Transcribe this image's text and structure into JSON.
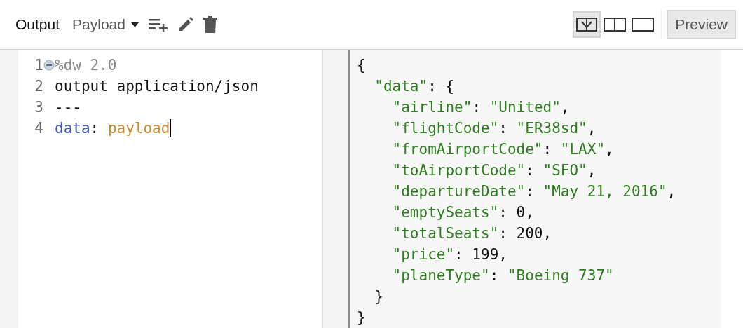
{
  "toolbar": {
    "title": "Output",
    "target": "Payload",
    "view_modes": [
      {
        "kind": "diff",
        "selected": true
      },
      {
        "kind": "split",
        "selected": false
      },
      {
        "kind": "single",
        "selected": false
      }
    ],
    "preview_button": "Preview"
  },
  "editor": {
    "lines": [
      {
        "number": "1",
        "foldable": true,
        "cursor": false,
        "tokens": [
          {
            "kind": "directive",
            "text": "%dw 2.0"
          }
        ]
      },
      {
        "number": "2",
        "foldable": false,
        "cursor": false,
        "tokens": [
          {
            "kind": "plain",
            "text": "output application/json"
          }
        ]
      },
      {
        "number": "3",
        "foldable": false,
        "cursor": false,
        "tokens": [
          {
            "kind": "plain",
            "text": "---"
          }
        ]
      },
      {
        "number": "4",
        "foldable": false,
        "cursor": true,
        "tokens": [
          {
            "kind": "field",
            "text": "data"
          },
          {
            "kind": "plain",
            "text": ": "
          },
          {
            "kind": "value",
            "text": "payload"
          }
        ]
      }
    ]
  },
  "preview": {
    "lines": [
      [
        {
          "kind": "punct",
          "text": "{"
        }
      ],
      [
        {
          "kind": "key",
          "text": "  \"data\""
        },
        {
          "kind": "punct",
          "text": ": {"
        }
      ],
      [
        {
          "kind": "key",
          "text": "    \"airline\""
        },
        {
          "kind": "punct",
          "text": ": "
        },
        {
          "kind": "string",
          "text": "\"United\""
        },
        {
          "kind": "punct",
          "text": ","
        }
      ],
      [
        {
          "kind": "key",
          "text": "    \"flightCode\""
        },
        {
          "kind": "punct",
          "text": ": "
        },
        {
          "kind": "string",
          "text": "\"ER38sd\""
        },
        {
          "kind": "punct",
          "text": ","
        }
      ],
      [
        {
          "kind": "key",
          "text": "    \"fromAirportCode\""
        },
        {
          "kind": "punct",
          "text": ": "
        },
        {
          "kind": "string",
          "text": "\"LAX\""
        },
        {
          "kind": "punct",
          "text": ","
        }
      ],
      [
        {
          "kind": "key",
          "text": "    \"toAirportCode\""
        },
        {
          "kind": "punct",
          "text": ": "
        },
        {
          "kind": "string",
          "text": "\"SFO\""
        },
        {
          "kind": "punct",
          "text": ","
        }
      ],
      [
        {
          "kind": "key",
          "text": "    \"departureDate\""
        },
        {
          "kind": "punct",
          "text": ": "
        },
        {
          "kind": "string",
          "text": "\"May 21, 2016\""
        },
        {
          "kind": "punct",
          "text": ","
        }
      ],
      [
        {
          "kind": "key",
          "text": "    \"emptySeats\""
        },
        {
          "kind": "punct",
          "text": ": 0,"
        }
      ],
      [
        {
          "kind": "key",
          "text": "    \"totalSeats\""
        },
        {
          "kind": "punct",
          "text": ": 200,"
        }
      ],
      [
        {
          "kind": "key",
          "text": "    \"price\""
        },
        {
          "kind": "punct",
          "text": ": 199,"
        }
      ],
      [
        {
          "kind": "key",
          "text": "    \"planeType\""
        },
        {
          "kind": "punct",
          "text": ": "
        },
        {
          "kind": "string",
          "text": "\"Boeing 737\""
        }
      ],
      [
        {
          "kind": "punct",
          "text": "  }"
        }
      ],
      [
        {
          "kind": "punct",
          "text": "}"
        }
      ]
    ]
  }
}
